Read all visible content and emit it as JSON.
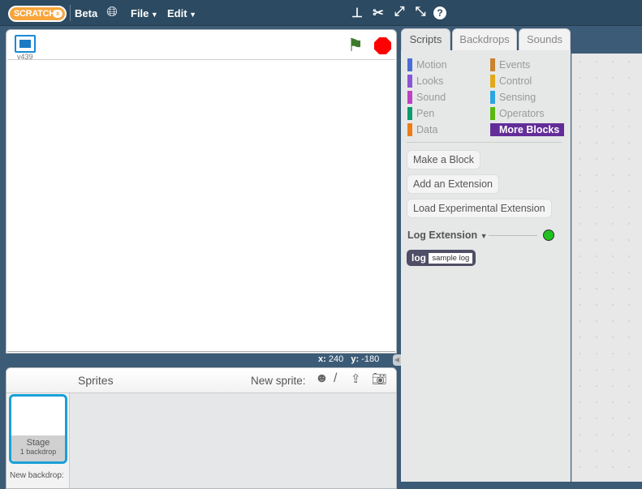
{
  "topbar": {
    "logo": "SCRATCH",
    "logo_badge": "x",
    "beta": "Beta",
    "file": "File",
    "edit": "Edit"
  },
  "stage": {
    "version": "v439",
    "coords_x_label": "x:",
    "coords_x": "240",
    "coords_y_label": "y:",
    "coords_y": "-180"
  },
  "sprites": {
    "title": "Sprites",
    "new_sprite": "New sprite:",
    "stage_label": "Stage",
    "backdrops": "1 backdrop",
    "new_backdrop": "New backdrop:"
  },
  "tabs": [
    "Scripts",
    "Backdrops",
    "Sounds"
  ],
  "categories": [
    {
      "label": "Motion",
      "color": "#4a6cd4"
    },
    {
      "label": "Events",
      "color": "#c88330"
    },
    {
      "label": "Looks",
      "color": "#8a55d7"
    },
    {
      "label": "Control",
      "color": "#e1a91a"
    },
    {
      "label": "Sound",
      "color": "#bb42c3"
    },
    {
      "label": "Sensing",
      "color": "#2ca5e2"
    },
    {
      "label": "Pen",
      "color": "#0e9a6c"
    },
    {
      "label": "Operators",
      "color": "#5cb712"
    },
    {
      "label": "Data",
      "color": "#ee7d16"
    },
    {
      "label": "More Blocks",
      "color": "#632d99"
    }
  ],
  "buttons": {
    "make_block": "Make a Block",
    "add_extension": "Add an Extension",
    "load_experimental": "Load Experimental Extension"
  },
  "extension": {
    "name": "Log Extension",
    "status_color": "#1fc11f",
    "block_label": "log",
    "block_arg": "sample log"
  }
}
